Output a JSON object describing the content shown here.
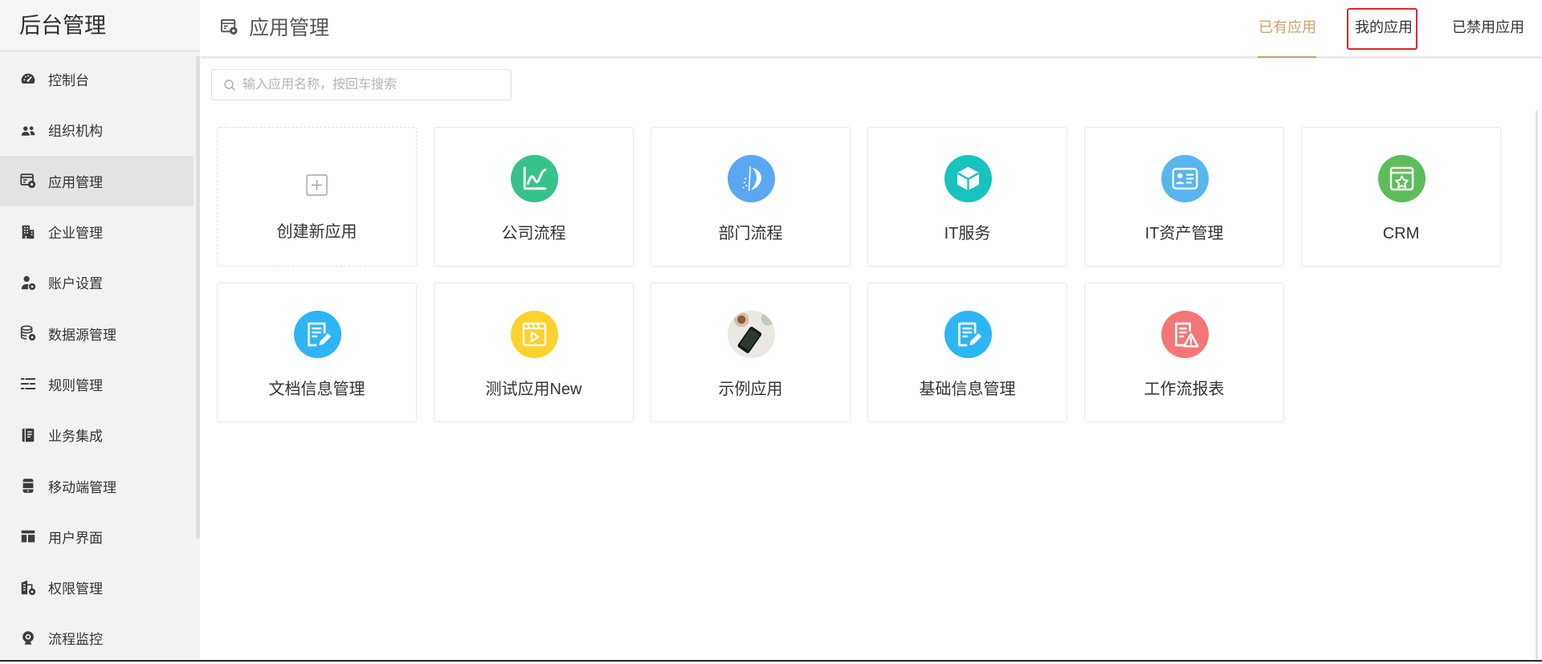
{
  "sidebar": {
    "title": "后台管理",
    "items": [
      {
        "label": "控制台",
        "icon": "dashboard-icon"
      },
      {
        "label": "组织机构",
        "icon": "people-icon"
      },
      {
        "label": "应用管理",
        "icon": "app-settings-icon",
        "active": true
      },
      {
        "label": "企业管理",
        "icon": "building-icon"
      },
      {
        "label": "账户设置",
        "icon": "user-settings-icon"
      },
      {
        "label": "数据源管理",
        "icon": "database-settings-icon"
      },
      {
        "label": "规则管理",
        "icon": "rules-list-icon"
      },
      {
        "label": "业务集成",
        "icon": "book-icon"
      },
      {
        "label": "移动端管理",
        "icon": "mobile-icon"
      },
      {
        "label": "用户界面",
        "icon": "layout-icon"
      },
      {
        "label": "权限管理",
        "icon": "permission-icon"
      },
      {
        "label": "流程监控",
        "icon": "webcam-icon"
      }
    ]
  },
  "header": {
    "title": "应用管理",
    "icon": "app-settings-icon"
  },
  "tabs": [
    {
      "label": "已有应用",
      "active": true
    },
    {
      "label": "我的应用",
      "highlighted": true
    },
    {
      "label": "已禁用应用"
    }
  ],
  "search": {
    "placeholder": "输入应用名称，按回车搜索",
    "value": "",
    "icon": "search-icon"
  },
  "create_app": {
    "label": "创建新应用",
    "icon": "plus-square-icon"
  },
  "apps": [
    {
      "label": "公司流程",
      "icon": "line-chart-icon",
      "color": "#35c28b"
    },
    {
      "label": "部门流程",
      "icon": "department-logo-icon",
      "color": "#5aa8f3"
    },
    {
      "label": "IT服务",
      "icon": "cube-icon",
      "color": "#16c3be"
    },
    {
      "label": "IT资产管理",
      "icon": "id-card-icon",
      "color": "#58b6ee"
    },
    {
      "label": "CRM",
      "icon": "star-box-icon",
      "color": "#5dbd5b"
    },
    {
      "label": "文档信息管理",
      "icon": "edit-document-icon",
      "color": "#2db5f5"
    },
    {
      "label": "测试应用New",
      "icon": "video-icon",
      "color": "#fdd22c"
    },
    {
      "label": "示例应用",
      "icon": "photo-thumbnail",
      "color": "#e8e5e0"
    },
    {
      "label": "基础信息管理",
      "icon": "edit-document-icon",
      "color": "#2db5f5"
    },
    {
      "label": "工作流报表",
      "icon": "report-warning-icon",
      "color": "#f47676"
    }
  ],
  "colors": {
    "accent": "#c9a46a",
    "highlight_box": "#e3262b",
    "sidebar_bg": "#f2f2f2",
    "sidebar_active_bg": "#e3e3e3"
  }
}
